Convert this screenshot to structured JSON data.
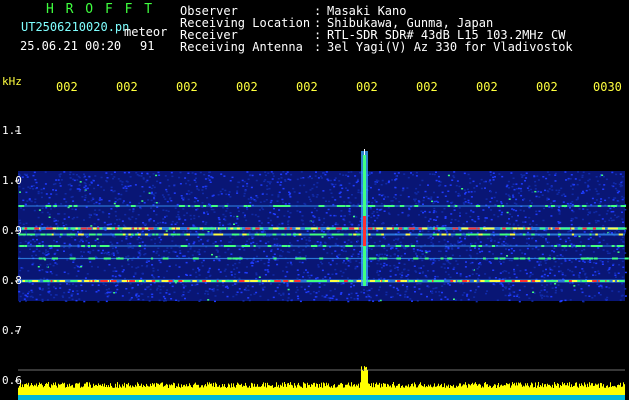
{
  "header": {
    "software_name": "H R O F F T",
    "filename": "UT2506210020.pn",
    "overlay_label": "meteor",
    "datetime": "25.06.21 00:20",
    "frame_value": "91",
    "info_labels": [
      "Observer",
      "Receiving Location",
      "Receiver",
      "Receiving Antenna"
    ],
    "info_separator": ":",
    "info_values": [
      "Masaki Kano",
      "Shibukawa, Gunma, Japan",
      "RTL-SDR SDR# 43dB L15 103.2MHz CW",
      "3el Yagi(V) Az 330 for Vladivostok"
    ]
  },
  "chart_data": {
    "type": "heatmap",
    "ylabel": "kHz",
    "y_ticks": [
      "1.1",
      "1.0",
      "0.9",
      "0.8",
      "0.7",
      "0.6"
    ],
    "y_tick_values": [
      1.1,
      1.0,
      0.9,
      0.8,
      0.7,
      0.6
    ],
    "x_ticks": [
      "002",
      "002",
      "002",
      "002",
      "002",
      "002",
      "002",
      "002",
      "002",
      "0030"
    ],
    "noise_band_khz": [
      0.76,
      1.02
    ],
    "carriers_khz": [
      {
        "freq": 0.8,
        "level": "strong"
      },
      {
        "freq": 0.845,
        "level": "weak"
      },
      {
        "freq": 0.87,
        "level": "weak"
      },
      {
        "freq": 0.893,
        "level": "medium"
      },
      {
        "freq": 0.905,
        "level": "strong"
      },
      {
        "freq": 0.95,
        "level": "weak"
      }
    ],
    "meteor_echo": {
      "x_tick_index": 5,
      "freq_range_khz": [
        0.79,
        1.06
      ]
    },
    "colors": {
      "background": "#000000",
      "noise": "#1e3cff",
      "carrier_core": "#ff3030",
      "carrier_mid": "#ffff40",
      "carrier_edge": "#40ff80",
      "signal_bars": "#ffff00",
      "axis_text": "#ffff3f",
      "tick_text": "#ffffff"
    }
  }
}
